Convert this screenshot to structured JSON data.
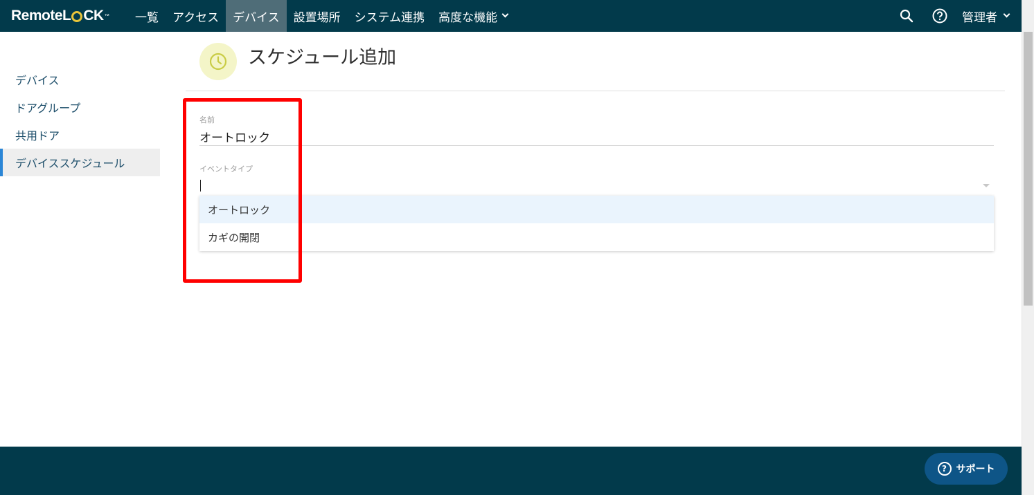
{
  "brand": {
    "logo_text_left": "Remote",
    "logo_text_l": "L",
    "logo_text_right": "CK",
    "logo_tm": "™"
  },
  "nav": {
    "items": [
      {
        "label": "一覧"
      },
      {
        "label": "アクセス"
      },
      {
        "label": "デバイス"
      },
      {
        "label": "設置場所"
      },
      {
        "label": "システム連携"
      },
      {
        "label": "高度な機能"
      }
    ],
    "active_index": 2,
    "user_label": "管理者"
  },
  "sidebar": {
    "items": [
      {
        "label": "デバイス"
      },
      {
        "label": "ドアグループ"
      },
      {
        "label": "共用ドア"
      },
      {
        "label": "デバイススケジュール"
      }
    ]
  },
  "header": {
    "title": "スケジュール追加"
  },
  "form": {
    "name_label": "名前",
    "name_value": "オートロック",
    "event_type_label": "イベントタイプ",
    "event_type_options": [
      "オートロック",
      "カギの開閉"
    ]
  },
  "footer": {
    "support_label": "サポート"
  },
  "colors": {
    "navbar": "#023a4b",
    "active_nav": "#4f6d78",
    "sidebar_accent": "#2b86d6",
    "highlight": "#ff0000",
    "support_button": "#0e5587"
  },
  "icons": [
    "search-icon",
    "help-icon",
    "clock-icon",
    "chevron-down-icon"
  ]
}
